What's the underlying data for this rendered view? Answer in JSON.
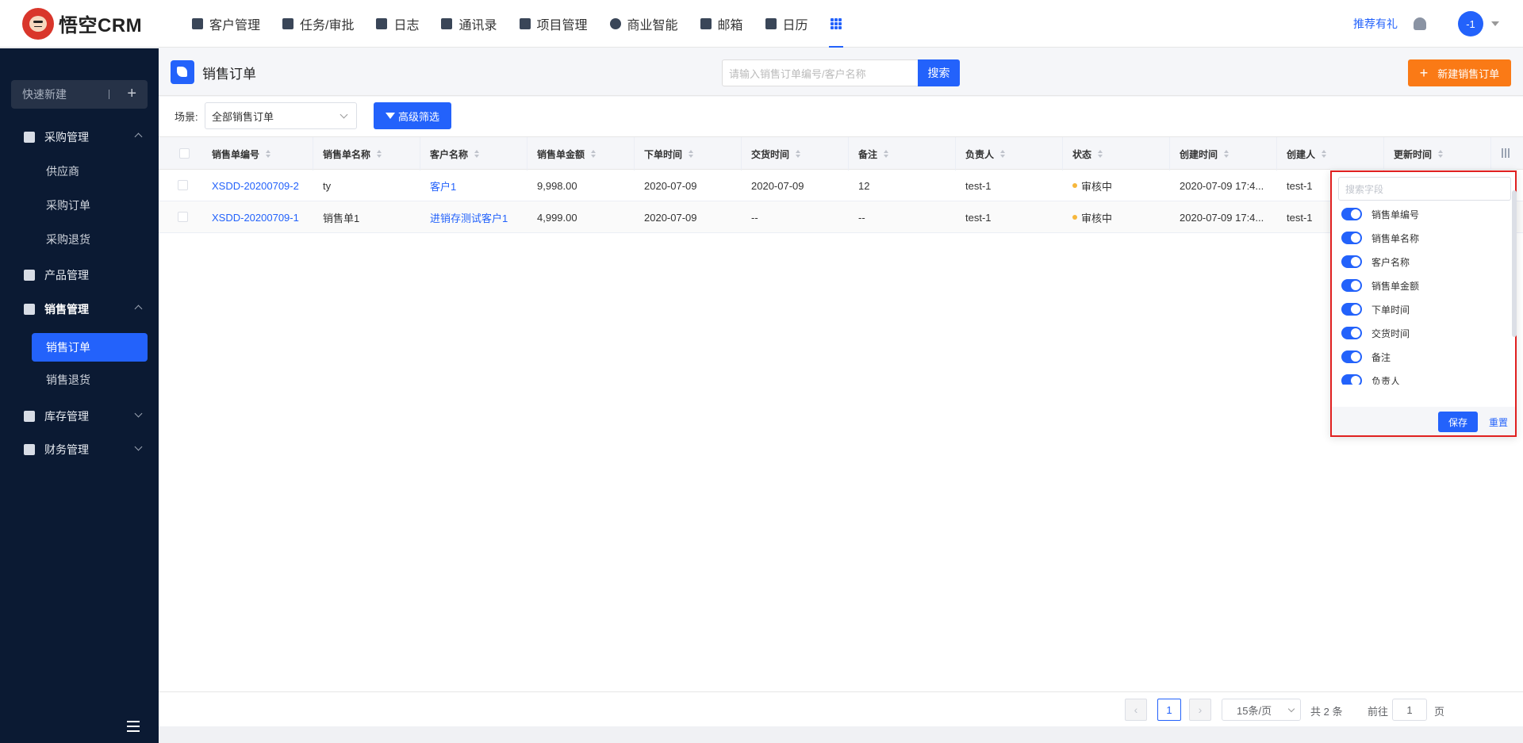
{
  "brand": {
    "name": "悟空CRM"
  },
  "nav": [
    {
      "label": "客户管理",
      "icon": "building-icon"
    },
    {
      "label": "任务/审批",
      "icon": "briefcase-icon"
    },
    {
      "label": "日志",
      "icon": "log-icon"
    },
    {
      "label": "通讯录",
      "icon": "phone-book-icon"
    },
    {
      "label": "项目管理",
      "icon": "project-icon"
    },
    {
      "label": "商业智能",
      "icon": "bi-icon"
    },
    {
      "label": "邮箱",
      "icon": "mail-icon"
    },
    {
      "label": "日历",
      "icon": "calendar-icon"
    }
  ],
  "topRight": {
    "recommend": "推荐有礼",
    "avatar": "-1"
  },
  "sidebar": {
    "quickNew": "快速新建",
    "groups": [
      {
        "label": "采购管理",
        "icon": "cart-icon",
        "sub": [
          "供应商",
          "采购订单",
          "采购退货"
        ]
      },
      {
        "label": "产品管理",
        "icon": "cube-icon"
      },
      {
        "label": "销售管理",
        "icon": "tag-icon",
        "sub": [
          "销售订单",
          "销售退货"
        ]
      },
      {
        "label": "库存管理",
        "icon": "warehouse-icon"
      },
      {
        "label": "财务管理",
        "icon": "wallet-icon"
      }
    ]
  },
  "page": {
    "title": "销售订单",
    "searchPlaceholder": "请输入销售订单编号/客户名称",
    "searchBtn": "搜索",
    "newBtn": "新建销售订单",
    "sceneLabel": "场景:",
    "sceneValue": "全部销售订单",
    "advancedFilter": "高级筛选"
  },
  "table": {
    "columns": [
      "销售单编号",
      "销售单名称",
      "客户名称",
      "销售单金额",
      "下单时间",
      "交货时间",
      "备注",
      "负责人",
      "状态",
      "创建时间",
      "创建人",
      "更新时间"
    ],
    "rows": [
      {
        "no": "XSDD-20200709-2",
        "name": "ty",
        "customer": "客户1",
        "amount": "9,998.00",
        "orderDate": "2020-07-09",
        "deliveryDate": "2020-07-09",
        "remark": "12",
        "owner": "test-1",
        "status": "审核中",
        "created": "2020-07-09 17:4...",
        "creator": "test-1"
      },
      {
        "no": "XSDD-20200709-1",
        "name": "销售单1",
        "customer": "进销存测试客户1",
        "amount": "4,999.00",
        "orderDate": "2020-07-09",
        "deliveryDate": "--",
        "remark": "--",
        "owner": "test-1",
        "status": "审核中",
        "created": "2020-07-09 17:4...",
        "creator": "test-1"
      }
    ]
  },
  "columnSettings": {
    "searchPlaceholder": "搜索字段",
    "fields": [
      "销售单编号",
      "销售单名称",
      "客户名称",
      "销售单金额",
      "下单时间",
      "交货时间",
      "备注",
      "负责人"
    ],
    "save": "保存",
    "reset": "重置"
  },
  "pagination": {
    "page": "1",
    "pageSize": "15条/页",
    "total": "共 2 条",
    "gotoLabel": "前往",
    "gotoValue": "1",
    "pageUnit": "页"
  }
}
